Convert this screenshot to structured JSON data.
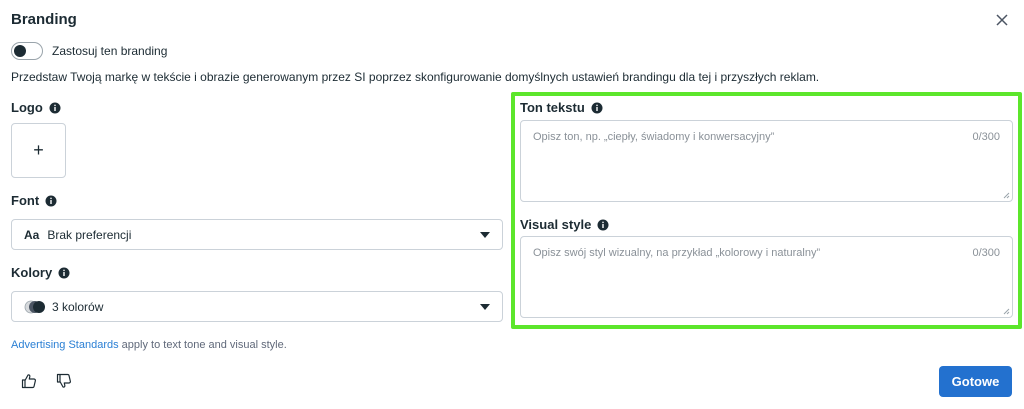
{
  "dialog": {
    "title": "Branding",
    "close_icon": "close-icon"
  },
  "toggle": {
    "label": "Zastosuj ten branding",
    "on": false
  },
  "description": "Przedstaw Twoją markę w tekście i obrazie generowanym przez SI poprzez skonfigurowanie domyślnych ustawień brandingu dla tej i przyszłych reklam.",
  "logo": {
    "label": "Logo",
    "add_symbol": "+"
  },
  "font": {
    "label": "Font",
    "lead": "Aa",
    "selected": "Brak preferencji"
  },
  "colors": {
    "label": "Kolory",
    "selected": "3 kolorów"
  },
  "tone": {
    "label": "Ton tekstu",
    "placeholder": "Opisz ton, np. „ciepły, świadomy i konwersacyjny”",
    "counter": "0/300"
  },
  "visual": {
    "label": "Visual style",
    "placeholder": "Opisz swój styl wizualny, na przykład „kolorowy i naturalny”",
    "counter": "0/300"
  },
  "disclaimer": {
    "link": "Advertising Standards",
    "rest": " apply to text tone and visual style."
  },
  "footer": {
    "done_label": "Gotowe"
  },
  "colors_theme": {
    "primary": "#2371cf",
    "highlight": "#5ce62b",
    "text": "#1c2b33"
  }
}
